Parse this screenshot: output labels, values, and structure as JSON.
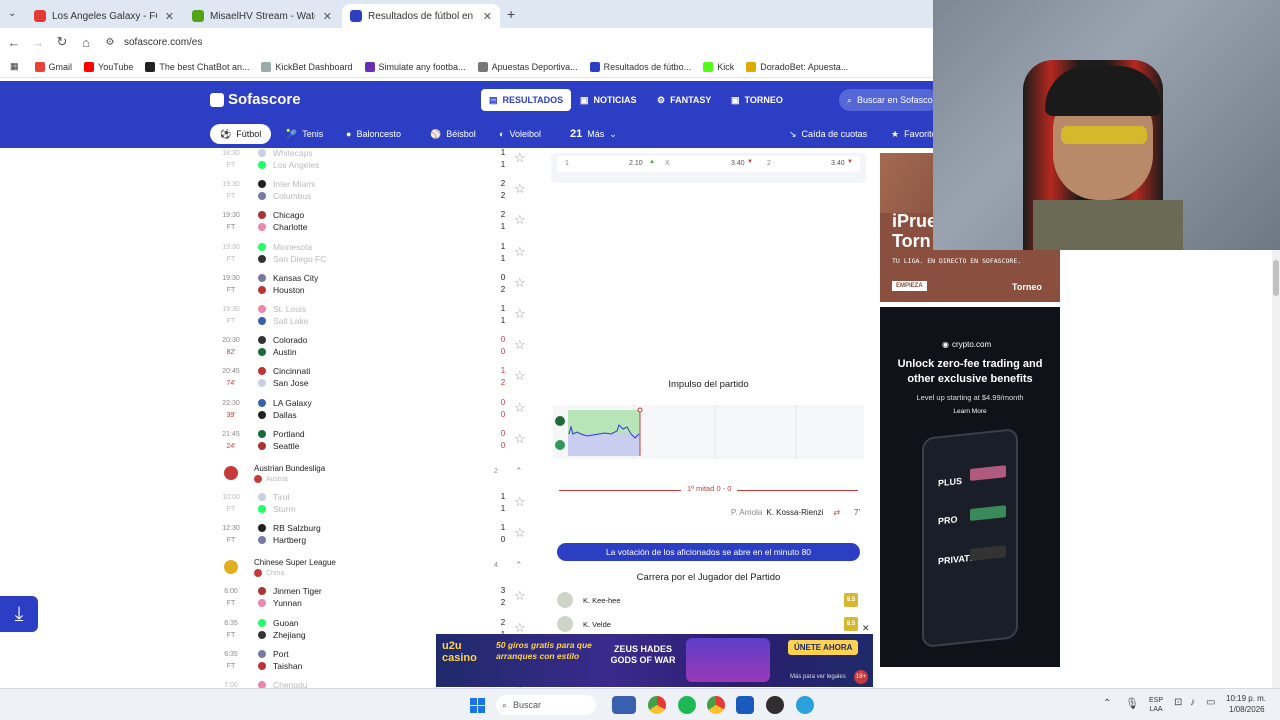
{
  "browser": {
    "tabs": [
      {
        "title": "Los Angeles Galaxy - FC Dallas",
        "color": "#e53935"
      },
      {
        "title": "MisaelHV Stream - Watch Live",
        "color": "#53a317"
      },
      {
        "title": "Resultados de fútbol en directo",
        "color": "#2c3ec4"
      }
    ],
    "new_tab": "+",
    "url": "sofascore.com/es",
    "bookmarks": [
      "Gmail",
      "YouTube",
      "The best ChatBot an...",
      "KickBet Dashboard",
      "Simulate any footba...",
      "Apuestas Deportiva...",
      "Resultados de fútbo...",
      "Kick",
      "DoradoBet: Apuesta..."
    ]
  },
  "header": {
    "logo": "Sofascore",
    "nav": [
      "RESULTADOS",
      "NOTICIAS",
      "FANTASY",
      "TORNEO"
    ],
    "search": "Buscar en Sofascore",
    "sports": [
      "Fútbol",
      "Tenis",
      "Baloncesto",
      "Béisbol",
      "Voleibol",
      "21",
      "Más",
      "Caída de cuotas",
      "Favoritos"
    ]
  },
  "matches": [
    {
      "time": "18:30",
      "status": "FT",
      "home": "Whitecaps",
      "away": "Los Angeles",
      "hs": "1",
      "as": "1",
      "faded": true
    },
    {
      "time": "19:30",
      "status": "FT",
      "home": "Inter Miami",
      "away": "Columbus",
      "hs": "2",
      "as": "2",
      "faded": true
    },
    {
      "time": "19:30",
      "status": "FT",
      "home": "Chicago",
      "away": "Charlotte",
      "hs": "2",
      "as": "1",
      "faded": false
    },
    {
      "time": "19:30",
      "status": "FT",
      "home": "Minnesota",
      "away": "San Diego FC",
      "hs": "1",
      "as": "1",
      "faded": true
    },
    {
      "time": "19:30",
      "status": "FT",
      "home": "Kansas City",
      "away": "Houston",
      "hs": "0",
      "as": "2",
      "faded": false
    },
    {
      "time": "19:30",
      "status": "FT",
      "home": "St. Louis",
      "away": "Salt Lake",
      "hs": "1",
      "as": "1",
      "faded": true
    },
    {
      "time": "20:30",
      "status": "82'",
      "home": "Colorado",
      "away": "Austin",
      "hs": "0",
      "as": "0",
      "faded": false
    },
    {
      "time": "20:45",
      "status": "74'",
      "home": "Cincinnati",
      "away": "San Jose",
      "hs": "1",
      "as": "2",
      "faded": false
    },
    {
      "time": "22:30",
      "status": "39'",
      "home": "LA Galaxy",
      "away": "Dallas",
      "hs": "0",
      "as": "0",
      "faded": false
    },
    {
      "time": "21:45",
      "status": "24'",
      "home": "Portland",
      "away": "Seattle",
      "hs": "0",
      "as": "0",
      "faded": false
    }
  ],
  "leagues": [
    {
      "name": "Austrian Bundesliga",
      "country": "Austria",
      "count": "2",
      "matches": [
        {
          "time": "10:00",
          "status": "FT",
          "home": "Tirol",
          "away": "Sturm",
          "hs": "1",
          "as": "1",
          "faded": true
        },
        {
          "time": "12:30",
          "status": "FT",
          "home": "RB Salzburg",
          "away": "Hartberg",
          "hs": "1",
          "as": "0",
          "faded": false
        }
      ]
    },
    {
      "name": "Chinese Super League",
      "country": "China",
      "count": "4",
      "matches": [
        {
          "time": "6:00",
          "status": "FT",
          "home": "Jinmen Tiger",
          "away": "Yunnan",
          "hs": "3",
          "as": "2",
          "faded": false
        },
        {
          "time": "6:35",
          "status": "FT",
          "home": "Guoan",
          "away": "Zhejiang",
          "hs": "2",
          "as": "1",
          "faded": false
        },
        {
          "time": "6:35",
          "status": "FT",
          "home": "Port",
          "away": "Taishan",
          "hs": "",
          "as": "",
          "faded": false
        },
        {
          "time": "7:00",
          "status": "",
          "home": "Chengdu",
          "away": "",
          "hs": "",
          "as": "",
          "faded": true
        }
      ]
    }
  ],
  "odds": {
    "c1": "1",
    "v1": "2.10",
    "cx": "X",
    "vx": "3.40",
    "c2": "2",
    "v2": "3.40"
  },
  "impulse_title": "Impulso del partido",
  "half_label": "1ª mitad 0 - 0",
  "event": {
    "assist": "P. Arriola",
    "player": "K. Kossa-Rienzi",
    "minute": "7'"
  },
  "vote_banner": "La votación de los aficionados se abre en el minuto 80",
  "race_title": "Carrera por el Jugador del Partido",
  "players": [
    {
      "name": "K. Kee-hee",
      "rating": "8.5"
    },
    {
      "name": "K. Velde",
      "rating": "8.5"
    }
  ],
  "ad_top": {
    "headline": "iPrue Torn",
    "subtitle": "TU LIGA. EN DIRECTO EN SOFASCORE.",
    "cta": "EMPIEZA",
    "brand": "Torneo"
  },
  "ad_crypto": {
    "brand": "crypto.com",
    "headline": "Unlock zero-fee trading and other exclusive benefits",
    "sub": "Level up starting at $4.99/month",
    "cta": "Learn More",
    "tiers": [
      "PLUS",
      "PRO",
      "PRIVATE"
    ]
  },
  "ad_bottom": {
    "logo": "u2u casino",
    "text": "50 giros gratis para que arranques con estilo",
    "game": "ZEUS HADES GODS OF WAR",
    "cta": "ÚNETE AHORA",
    "small": "Más para ver legales",
    "age": "18+"
  },
  "taskbar": {
    "search": "Buscar",
    "lang": "ESP LAA",
    "time": "10:19 p. m.",
    "date": "1/08/2026"
  }
}
